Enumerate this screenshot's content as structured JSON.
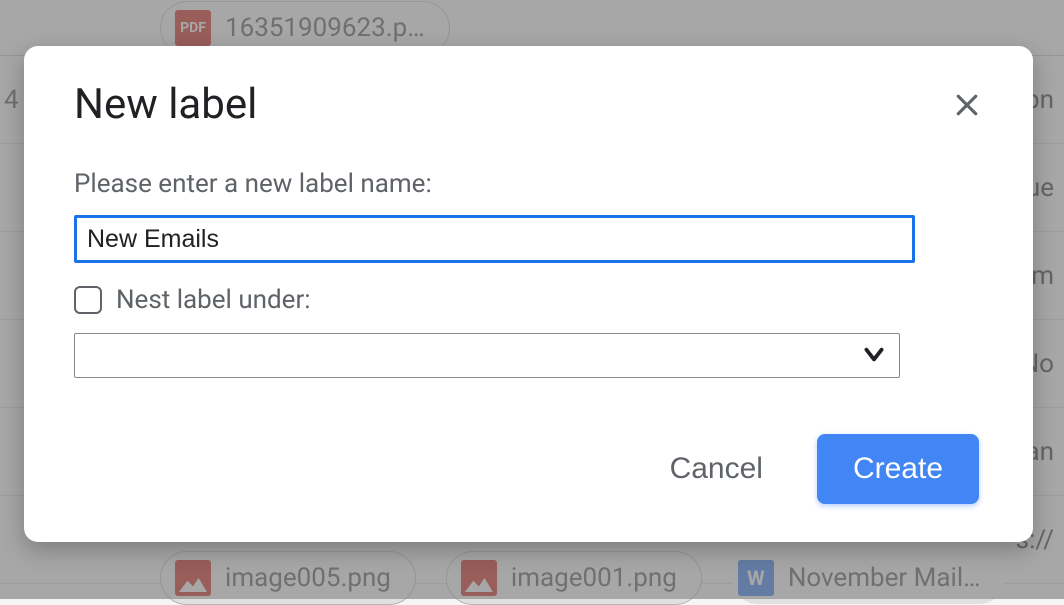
{
  "background": {
    "chip_top": "16351909623.p…",
    "row1_left": "4",
    "row1_right": "pn",
    "row2_right": "Tue",
    "row3_right": "m",
    "row4_right": "No",
    "row5_right": "an",
    "row6_right": "s://",
    "chip_img1": "image005.png",
    "chip_img2": "image001.png",
    "chip_doc": "November Mail…",
    "pdf_label": "PDF",
    "doc_label": "W"
  },
  "modal": {
    "title": "New label",
    "prompt": "Please enter a new label name:",
    "input_value": "New Emails",
    "nest_label": "Nest label under:",
    "select_value": "",
    "cancel": "Cancel",
    "create": "Create"
  }
}
